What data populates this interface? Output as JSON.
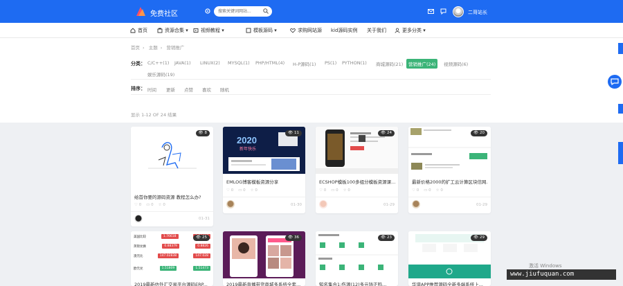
{
  "header": {
    "site_name": "免费社区",
    "search_placeholder": "搜索关键词网站...",
    "user_name": "二哥站长"
  },
  "nav": [
    {
      "label": "首页",
      "icon": "home-icon"
    },
    {
      "label": "资源合集 ▾",
      "icon": "store-icon"
    },
    {
      "label": "视频教程 ▾",
      "icon": "video-icon"
    },
    {
      "label": "模板源码 ▾",
      "icon": "code-icon"
    },
    {
      "label": "求购网站源",
      "icon": "heart-icon"
    },
    {
      "label": "kid源码实例",
      "icon": ""
    },
    {
      "label": "关于我们",
      "icon": ""
    },
    {
      "label": "更多分类 ▾",
      "icon": "user-icon"
    }
  ],
  "breadcrumb": [
    "首页",
    "主题",
    "营销推广"
  ],
  "filters": {
    "category_label": "分类：",
    "categories": [
      "C/C++(1)",
      "JAVA(1)",
      "LINUX(2)",
      "MYSQL(1)",
      "PHP/HTML(4)",
      "H-P源码(1)",
      "PS(1)",
      "PYTHON(1)",
      "商城源码(21)",
      "营销推广(24)",
      "视频源码(6)"
    ],
    "categories_row2": [
      "娱乐源码(19)"
    ],
    "active_index": 9,
    "sort_label": "排序：",
    "sorts": [
      "时间",
      "更新",
      "点赞",
      "喜欢",
      "随机"
    ]
  },
  "result_count": "显示 1-12 OF 24 结果",
  "cards": [
    {
      "badge": "8",
      "title": "给首你要的源码资源 教程怎么办?",
      "likes": "0",
      "comments": "0",
      "views": "0",
      "date": "01-31"
    },
    {
      "badge": "11",
      "title": "EMLOG博客模板资源分享",
      "likes": "0",
      "comments": "0",
      "views": "0",
      "date": "01-30"
    },
    {
      "badge": "24",
      "title": "ECSHOP模板100多组分模板资源课...",
      "likes": "0",
      "comments": "0",
      "views": "0",
      "date": "01-29"
    },
    {
      "badge": "20",
      "title": "最新价格2000的扩工云计算区块信网...",
      "likes": "0",
      "comments": "0",
      "views": "0",
      "date": "01-29"
    },
    {
      "badge": "25",
      "title": "2019最新仿外汇交易平台源码ERP...",
      "date": ""
    },
    {
      "badge": "36",
      "title": "2019最新直播带货商城多系统全套...",
      "date": ""
    },
    {
      "badge": "23",
      "title": "知名集合1:伤源(12)多元钱正吗...",
      "date": ""
    },
    {
      "badge": "29",
      "title": "华谱APP推荐源码全新多端系统上...",
      "date": ""
    }
  ],
  "rates": [
    {
      "name": "美国比较",
      "a": "1.76618",
      "b": "1.76627"
    },
    {
      "name": "英镑兑换",
      "a": "0.88379",
      "b": "0.8826"
    },
    {
      "name": "澳元比",
      "a": "147.02838",
      "b": "147.028"
    },
    {
      "name": "欧元兑",
      "a": "1.51809",
      "b": "1.51473"
    }
  ],
  "watermark": "www.jiufuquan.com",
  "windows_notice": "激活 Windows"
}
